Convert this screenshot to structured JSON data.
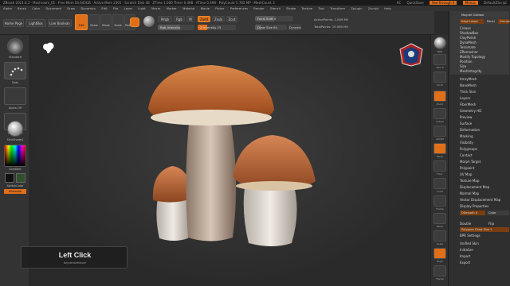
{
  "titlebar": {
    "text": "ZBrush 2021.6.2 · Mushroom_01 · Free Mem 54.645GB · Active Mem 2301 · Scratch Disk 48 · ZTime 1.000 Timer 0.498 · ATime 0.498 · PolyCount 5.783 MP · MeshCount 3",
    "items": [
      "AC",
      "QuickSave",
      "See-through 0",
      "Menus",
      "DefaultZScript"
    ]
  },
  "menubar": {
    "items": [
      "Alpha",
      "Brush",
      "Color",
      "Document",
      "Draw",
      "Dynamics",
      "Edit",
      "File",
      "Layer",
      "Light",
      "Macro",
      "Marker",
      "Material",
      "Movie",
      "Picker",
      "Preferences",
      "Render",
      "Stencil",
      "Stroke",
      "Texture",
      "Tool",
      "Transform",
      "Zplugin",
      "Zscript",
      "Help"
    ]
  },
  "toolbar": {
    "tabs": [
      "Home Page",
      "LightBox",
      "Live Boolean"
    ],
    "edit": "Edit",
    "draw": "Draw",
    "move": "Move",
    "scale": "Scale",
    "rotate": "Rotate",
    "mrgb": "Mrgb",
    "rgb": "Rgb",
    "m": "M",
    "zadd": "Zadd",
    "zsub": "Zsub",
    "zcut": "Zcut",
    "z_intensity": "Z Intensity 25",
    "rgb_intensity": "Rgb Intensity",
    "focal_shift": "Focal Shift 0",
    "draw_size": "Draw Size 64",
    "dynamic": "Dynamic",
    "active_points": "ActivePoints: 1.806 Mil",
    "total_points": "TotalPoints: 10.580 Mil"
  },
  "left": {
    "labels": [
      "Standard",
      "Dots",
      "Alpha Off",
      "Texture Off",
      "SkinShade4",
      "Gradient",
      "SwitchColor",
      "Alternate"
    ]
  },
  "overlay": {
    "title": "Left Click",
    "subtitle": "KeystrokeHelper"
  },
  "rightshelf": {
    "labels": [
      "BPR",
      "SPix 3",
      "Scroll",
      "Zoom",
      "Actual",
      "AAHalf",
      "Persp",
      "Floor",
      "Local",
      "Frame",
      "Move",
      "Scale",
      "Rotate",
      "Line Fill",
      "PolyF",
      "Transp",
      "Ghost",
      "Solo",
      "Xpose"
    ]
  },
  "tray": {
    "top": [
      "Magnet Subtool",
      "Edge Loops",
      "Panel",
      "Groups"
    ],
    "subitems": [
      "Crease",
      "ShadowBox",
      "ClayPolish",
      "DynaMesh",
      "Tessimate",
      "ZRemesher",
      "Modify Topology",
      "Position",
      "Size",
      "MeshIntegrity"
    ],
    "items": [
      "ArrayMesh",
      "NanoMesh",
      "Thick Skin",
      "Layers",
      "FiberMesh",
      "Geometry HD",
      "Preview",
      "Surface",
      "Deformation",
      "Masking",
      "Visibility",
      "Polygroups",
      "Contact",
      "Morph Target",
      "Polypaint",
      "UV Map",
      "Texture Map",
      "Displacement Map",
      "Normal Map",
      "Vector Displacement Map",
      "Display Properties"
    ],
    "display": {
      "double": "Double",
      "flip": "Flip",
      "polyframe": "Polygons Draw Size 1",
      "bpr": "BPR Settings",
      "dsmooth": "DSmooth 0",
      "color": "Color"
    },
    "bottom": [
      "Unified Skin",
      "Initialize",
      "Import",
      "Export"
    ]
  },
  "colors": {
    "accent": "#e06f1a",
    "panel": "#333333",
    "canvas": "#2b2b2b"
  }
}
